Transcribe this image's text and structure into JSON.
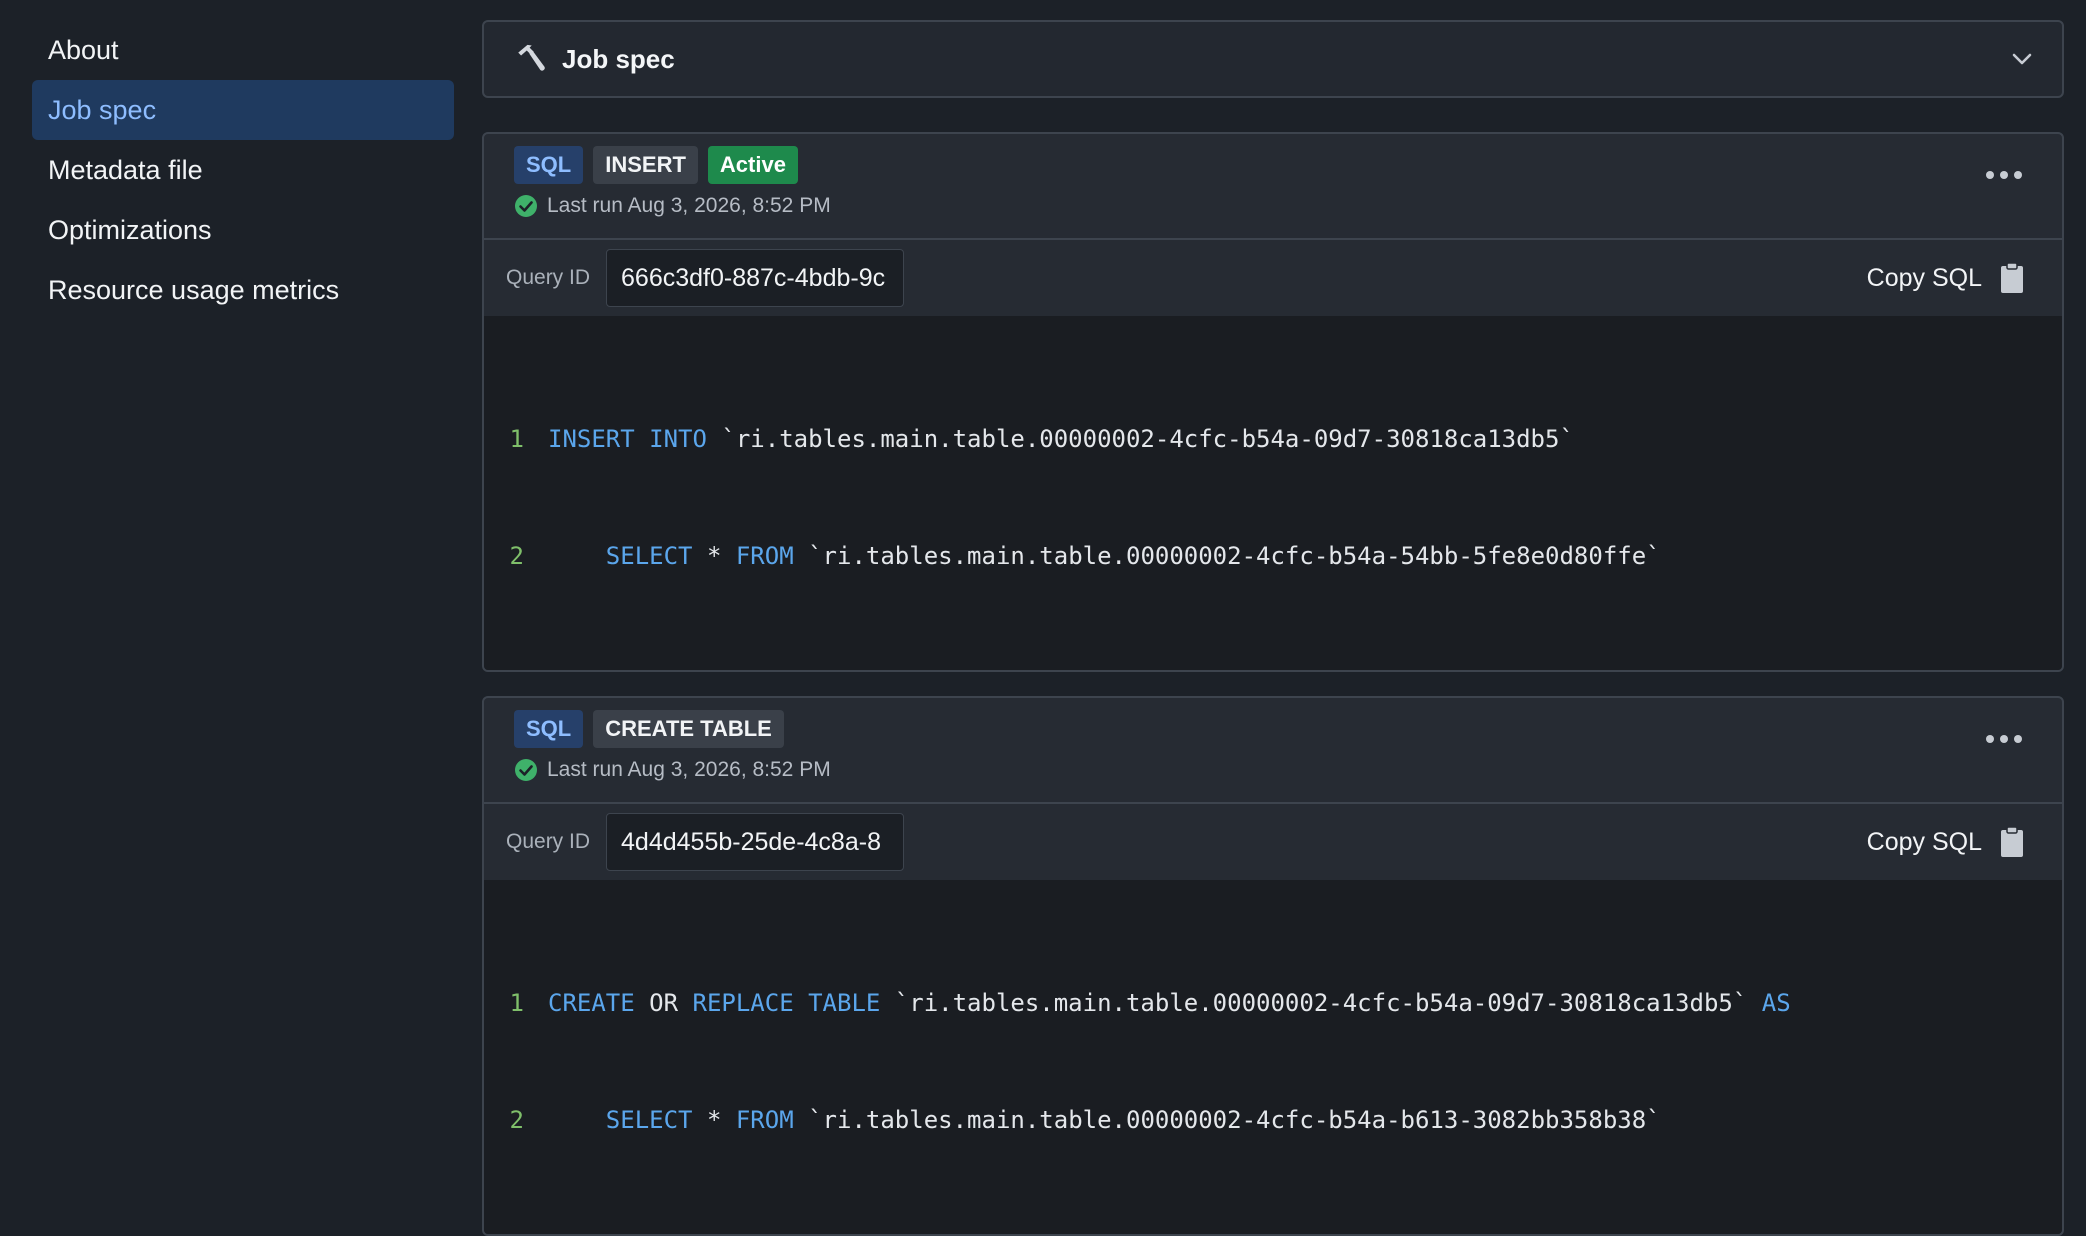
{
  "sidebar": {
    "items": [
      {
        "label": "About"
      },
      {
        "label": "Job spec",
        "active": true
      },
      {
        "label": "Metadata file"
      },
      {
        "label": "Optimizations"
      },
      {
        "label": "Resource usage metrics"
      }
    ]
  },
  "job_spec": {
    "title": "Job spec",
    "icon": "hammer-icon",
    "toggle_icon": "chevron-down-icon"
  },
  "cards": [
    {
      "tags": {
        "lang": "SQL",
        "kind": "INSERT",
        "status": "Active"
      },
      "last_run": "Last run Aug 3, 2026, 8:52 PM",
      "query_id_label": "Query ID",
      "query_id": "666c3df0-887c-4bdb-9c",
      "copy_label": "Copy SQL",
      "code": [
        {
          "num": "1",
          "indent": "",
          "kw1": "INSERT INTO",
          "t1": " `ri.tables.main.table.00000002-4cfc-b54a-09d7-30818ca13db5`",
          "kw2": "",
          "t2": ""
        },
        {
          "num": "2",
          "indent": "    ",
          "kw1": "SELECT",
          "t1": " * ",
          "kw2": "FROM",
          "t2": " `ri.tables.main.table.00000002-4cfc-b54a-54bb-5fe8e0d80ffe`"
        }
      ]
    },
    {
      "tags": {
        "lang": "SQL",
        "kind": "CREATE TABLE"
      },
      "last_run": "Last run Aug 3, 2026, 8:52 PM",
      "query_id_label": "Query ID",
      "query_id": "4d4d455b-25de-4c8a-8",
      "copy_label": "Copy SQL",
      "code": [
        {
          "num": "1",
          "indent": "",
          "kw1": "CREATE",
          "t1": " OR ",
          "kw2": "REPLACE TABLE",
          "t2": " `ri.tables.main.table.00000002-4cfc-b54a-09d7-30818ca13db5` ",
          "kw3": "AS"
        },
        {
          "num": "2",
          "indent": "    ",
          "kw1": "SELECT",
          "t1": " * ",
          "kw2": "FROM",
          "t2": " `ri.tables.main.table.00000002-4cfc-b54a-b613-3082bb358b38`"
        }
      ]
    }
  ],
  "colors": {
    "background": "#1c2128",
    "active_nav_bg": "#1f3a5f",
    "active_nav_text": "#8ebdff",
    "sql_keyword": "#5ba6ec",
    "line_number": "#7fbf6a",
    "status_active": "#1e8a4c",
    "success_check": "#3fb16a"
  }
}
